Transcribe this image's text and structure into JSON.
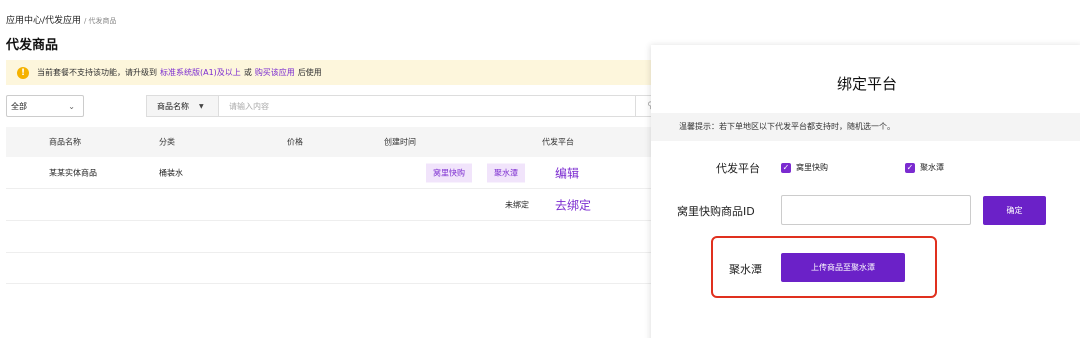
{
  "breadcrumb": {
    "part1": "应用中心",
    "part2": "/代发应用",
    "current": "/ 代发商品"
  },
  "page_title": "代发商品",
  "notice": {
    "icon": "warning-icon",
    "text_before": "当前套餐不支持该功能，请升级到",
    "link1": "标准系统版(A1)及以上",
    "text_mid": "或",
    "link2": "购买该应用",
    "text_after": "后使用"
  },
  "filter": {
    "selected": "全部"
  },
  "search": {
    "field": "商品名称",
    "placeholder": "请输入内容"
  },
  "table": {
    "headers": [
      "商品名称",
      "分类",
      "价格",
      "创建时间",
      "代发平台"
    ],
    "row1": {
      "name": "某某实体商品",
      "category": "桶装水",
      "tag1": "窝里快购",
      "tag2": "聚水潭",
      "action": "编辑"
    },
    "row2": {
      "status": "未绑定",
      "action": "去绑定"
    }
  },
  "modal": {
    "title": "绑定平台",
    "tip": "温馨提示：若下单地区以下代发平台都支持时，随机选一个。",
    "platform_label": "代发平台",
    "platform_options": [
      "窝里快购",
      "聚水潭"
    ],
    "id_label": "窝里快购商品ID",
    "id_value": "",
    "confirm": "确定",
    "jst_label": "聚水潭",
    "upload_button": "上传商品至聚水潭"
  },
  "colors": {
    "accent": "#6b21c8",
    "link": "#7b2bd0",
    "highlight": "#e0301e",
    "notice_bg": "#fdf6dc"
  }
}
